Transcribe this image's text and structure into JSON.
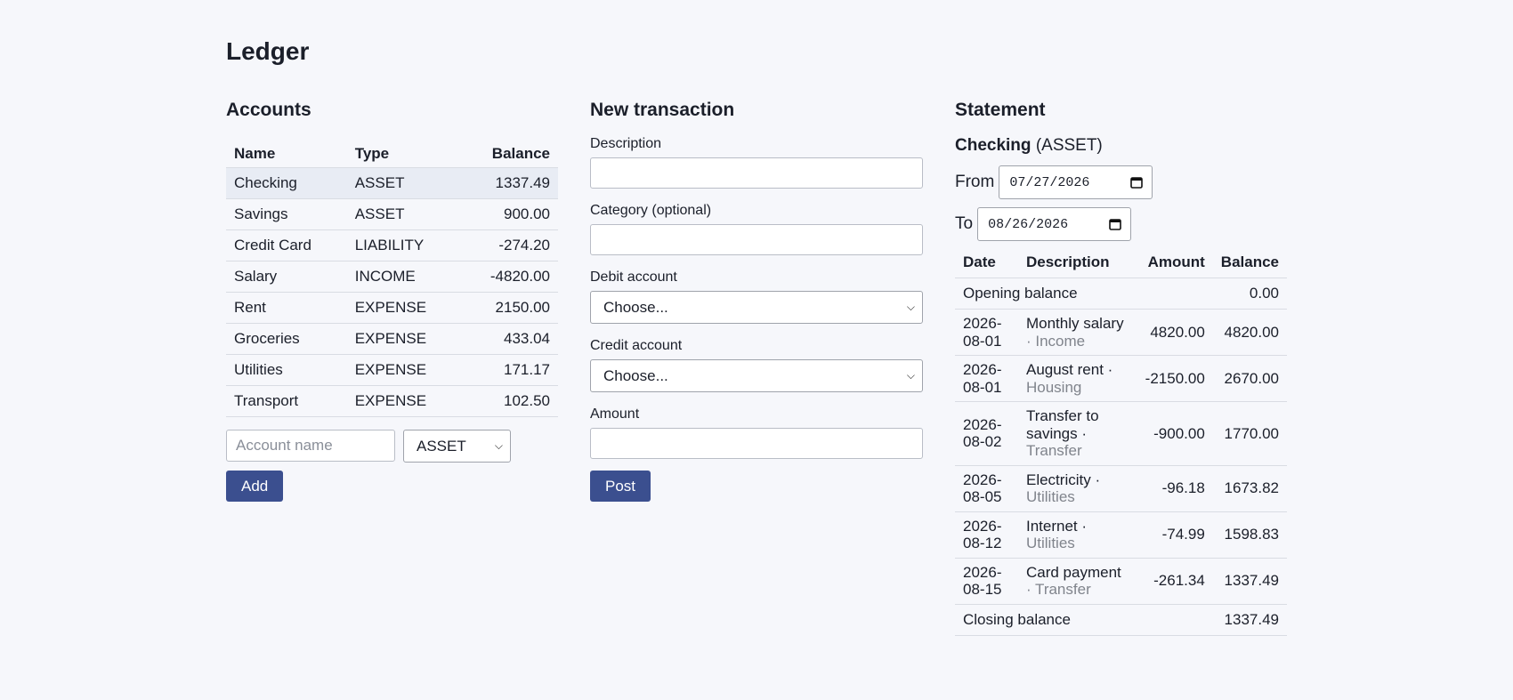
{
  "page": {
    "title": "Ledger"
  },
  "accounts": {
    "heading": "Accounts",
    "columns": {
      "name": "Name",
      "type": "Type",
      "balance": "Balance"
    },
    "rows": [
      {
        "name": "Checking",
        "type": "ASSET",
        "balance": "1337.49"
      },
      {
        "name": "Savings",
        "type": "ASSET",
        "balance": "900.00"
      },
      {
        "name": "Credit Card",
        "type": "LIABILITY",
        "balance": "-274.20"
      },
      {
        "name": "Salary",
        "type": "INCOME",
        "balance": "-4820.00"
      },
      {
        "name": "Rent",
        "type": "EXPENSE",
        "balance": "2150.00"
      },
      {
        "name": "Groceries",
        "type": "EXPENSE",
        "balance": "433.04"
      },
      {
        "name": "Utilities",
        "type": "EXPENSE",
        "balance": "171.17"
      },
      {
        "name": "Transport",
        "type": "EXPENSE",
        "balance": "102.50"
      }
    ],
    "selected_index": 0,
    "new_account": {
      "name_placeholder": "Account name",
      "name_value": "",
      "type_value": "ASSET",
      "add_label": "Add"
    }
  },
  "transaction": {
    "heading": "New transaction",
    "description_label": "Description",
    "description_value": "",
    "category_label": "Category (optional)",
    "category_value": "",
    "debit_label": "Debit account",
    "debit_value": "Choose...",
    "credit_label": "Credit account",
    "credit_value": "Choose...",
    "amount_label": "Amount",
    "amount_value": "",
    "post_label": "Post"
  },
  "statement": {
    "heading": "Statement",
    "account_name": "Checking",
    "account_type": "(ASSET)",
    "from_label": "From",
    "from_value": "07/27/2026",
    "to_label": "To",
    "to_value": "08/26/2026",
    "columns": {
      "date": "Date",
      "description": "Description",
      "amount": "Amount",
      "balance": "Balance"
    },
    "opening_label": "Opening balance",
    "opening_balance": "0.00",
    "rows": [
      {
        "date_year": "2026-",
        "date_md": "08-01",
        "desc": "Monthly salary",
        "category": "· Income",
        "amount": "4820.00",
        "balance": "4820.00"
      },
      {
        "date_year": "2026-",
        "date_md": "08-01",
        "desc": "August rent ·",
        "category": "Housing",
        "amount": "-2150.00",
        "balance": "2670.00"
      },
      {
        "date_year": "2026-",
        "date_md": "08-02",
        "desc": "Transfer to savings ·",
        "category": "Transfer",
        "amount": "-900.00",
        "balance": "1770.00"
      },
      {
        "date_year": "2026-",
        "date_md": "08-05",
        "desc": "Electricity ·",
        "category": "Utilities",
        "amount": "-96.18",
        "balance": "1673.82"
      },
      {
        "date_year": "2026-",
        "date_md": "08-12",
        "desc": "Internet ·",
        "category": "Utilities",
        "amount": "-74.99",
        "balance": "1598.83"
      },
      {
        "date_year": "2026-",
        "date_md": "08-15",
        "desc": "Card payment",
        "category": "· Transfer",
        "amount": "-261.34",
        "balance": "1337.49"
      }
    ],
    "closing_label": "Closing balance",
    "closing_balance": "1337.49"
  },
  "icons": {
    "select_arrow": "chevron-down-icon",
    "date_picker": "calendar-icon"
  },
  "colors": {
    "background": "#f6f7fb",
    "primary_button": "#3b4f8f",
    "selected_row": "#e8ecf4",
    "muted_text": "#80848c"
  }
}
